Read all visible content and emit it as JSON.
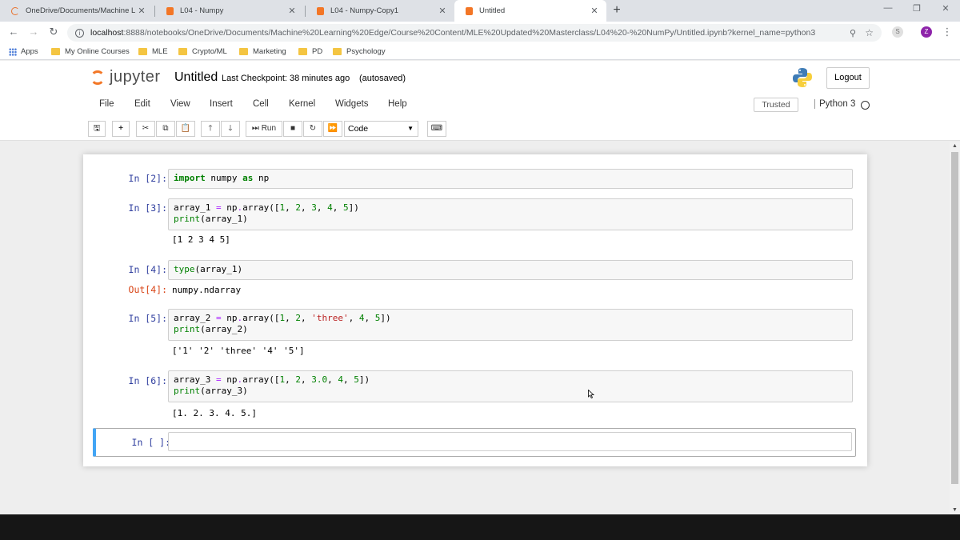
{
  "browser": {
    "tabs": [
      {
        "title": "OneDrive/Documents/Machine L",
        "close": "✕",
        "active": false
      },
      {
        "title": "L04 - Numpy",
        "close": "✕",
        "active": false
      },
      {
        "title": "L04 - Numpy-Copy1",
        "close": "✕",
        "active": false
      },
      {
        "title": "Untitled",
        "close": "✕",
        "active": true
      }
    ],
    "new_tab": "+",
    "url_host": "localhost",
    "url_rest": ":8888/notebooks/OneDrive/Documents/Machine%20Learning%20Edge/Course%20Content/MLE%20Updated%20Masterclass/L04%20-%20NumPy/Untitled.ipynb?kernel_name=python3",
    "profile_initial": "Z",
    "bookmarks": [
      {
        "label": "Apps",
        "kind": "apps"
      },
      {
        "label": "My Online Courses",
        "kind": "folder"
      },
      {
        "label": "MLE",
        "kind": "folder"
      },
      {
        "label": "Crypto/ML",
        "kind": "folder"
      },
      {
        "label": "Marketing",
        "kind": "folder"
      },
      {
        "label": "PD",
        "kind": "folder"
      },
      {
        "label": "Psychology",
        "kind": "folder"
      }
    ]
  },
  "jupyter": {
    "logo_text": "jupyter",
    "notebook_title": "Untitled",
    "checkpoint": "Last Checkpoint: 38 minutes ago",
    "autosave": "(autosaved)",
    "logout": "Logout",
    "menu": [
      "File",
      "Edit",
      "View",
      "Insert",
      "Cell",
      "Kernel",
      "Widgets",
      "Help"
    ],
    "trusted": "Trusted",
    "kernel": "Python 3",
    "toolbar": {
      "run_label": "Run",
      "cell_type": "Code"
    }
  },
  "cells": [
    {
      "prompt": "In [2]:",
      "code_lines": [
        "import numpy as np"
      ],
      "output": null
    },
    {
      "prompt": "In [3]:",
      "code_lines": [
        "array_1 = np.array([1, 2, 3, 4, 5])",
        "print(array_1)"
      ],
      "output": "[1 2 3 4 5]"
    },
    {
      "prompt": "In [4]:",
      "code_lines": [
        "type(array_1)"
      ],
      "out_prompt": "Out[4]:",
      "output": "numpy.ndarray"
    },
    {
      "prompt": "In [5]:",
      "code_lines": [
        "array_2 = np.array([1, 2, 'three', 4, 5])",
        "print(array_2)"
      ],
      "output": "['1' '2' 'three' '4' '5']"
    },
    {
      "prompt": "In [6]:",
      "code_lines": [
        "array_3 = np.array([1, 2, 3.0, 4, 5])",
        "print(array_3)"
      ],
      "output": "[1. 2. 3. 4. 5.]"
    },
    {
      "prompt": "In [ ]:",
      "code_lines": [
        ""
      ],
      "output": null
    }
  ],
  "colors": {
    "accent_orange": "#f37726",
    "prompt_in": "#303f9f",
    "prompt_out": "#d84315",
    "selected_border": "#42a5f5"
  }
}
